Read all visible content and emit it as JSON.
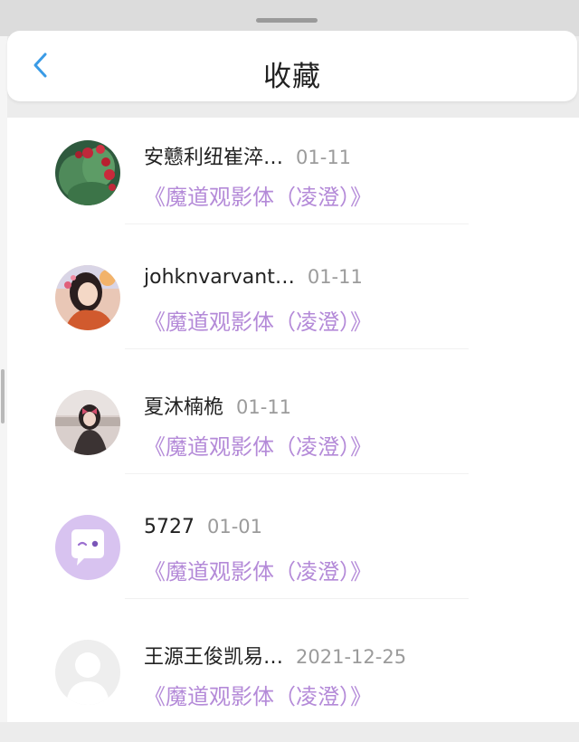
{
  "header": {
    "title": "收藏",
    "back_icon": "chevron-left-icon",
    "accent": "#3a9be6"
  },
  "favorites": [
    {
      "name": "安戆利纽崔淬…",
      "date": "01-11",
      "work": "《魔道观影体（凌澄）》",
      "avatar": "cactus-photo"
    },
    {
      "name": "johknvarvant…",
      "date": "01-11",
      "work": "《魔道观影体（凌澄）》",
      "avatar": "anime-girl-avatar"
    },
    {
      "name": "夏沐楠桅",
      "date": "01-11",
      "work": "《魔道观影体（凌澄）》",
      "avatar": "girl-photo-avatar"
    },
    {
      "name": "5727",
      "date": "01-01",
      "work": "《魔道观影体（凌澄）》",
      "avatar": "chat-bubble-avatar"
    },
    {
      "name": "王源王俊凯易…",
      "date": "2021-12-25",
      "work": "《魔道观影体（凌澄）》",
      "avatar": "default-user-avatar"
    }
  ],
  "colors": {
    "link": "#b48ad8",
    "date": "#9b9b9b",
    "text": "#222222"
  }
}
